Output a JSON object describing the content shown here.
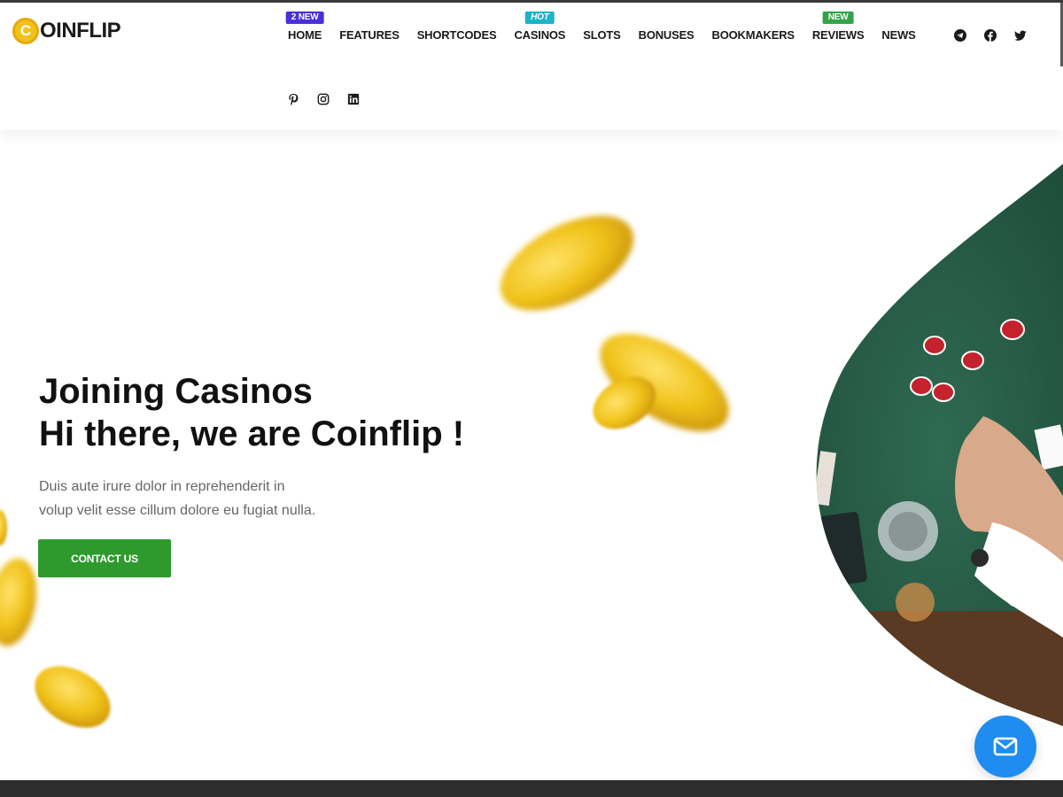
{
  "logo": {
    "letter": "C",
    "text": "OINFLIP"
  },
  "nav": {
    "items": [
      {
        "label": "HOME",
        "badge": "2 NEW"
      },
      {
        "label": "FEATURES"
      },
      {
        "label": "SHORTCODES"
      },
      {
        "label": "CASINOS",
        "badge": "HOT"
      },
      {
        "label": "SLOTS"
      },
      {
        "label": "BONUSES"
      },
      {
        "label": "BOOKMAKERS"
      },
      {
        "label": "REVIEWS",
        "badge": "NEW"
      },
      {
        "label": "NEWS"
      }
    ]
  },
  "social": {
    "top": [
      "telegram-icon",
      "facebook-icon",
      "twitter-icon"
    ],
    "bottom": [
      "pinterest-icon",
      "instagram-icon",
      "linkedin-icon"
    ]
  },
  "hero": {
    "title_line1": "Joining Casinos",
    "title_line2": "Hi there, we are Coinflip !",
    "text_line1": "Duis aute irure dolor in reprehenderit in",
    "text_line2": "volup velit esse cillum dolore eu fugiat nulla.",
    "cta_label": "CONTACT US"
  },
  "fab": {
    "icon": "envelope-icon"
  },
  "colors": {
    "accent_green": "#2e9a2e",
    "badge_blue": "#4a2fd8",
    "badge_teal": "#1ab4c7",
    "badge_green": "#33a34a",
    "fab_blue": "#1e8cf0",
    "coin_gold": "#f3c21a"
  }
}
